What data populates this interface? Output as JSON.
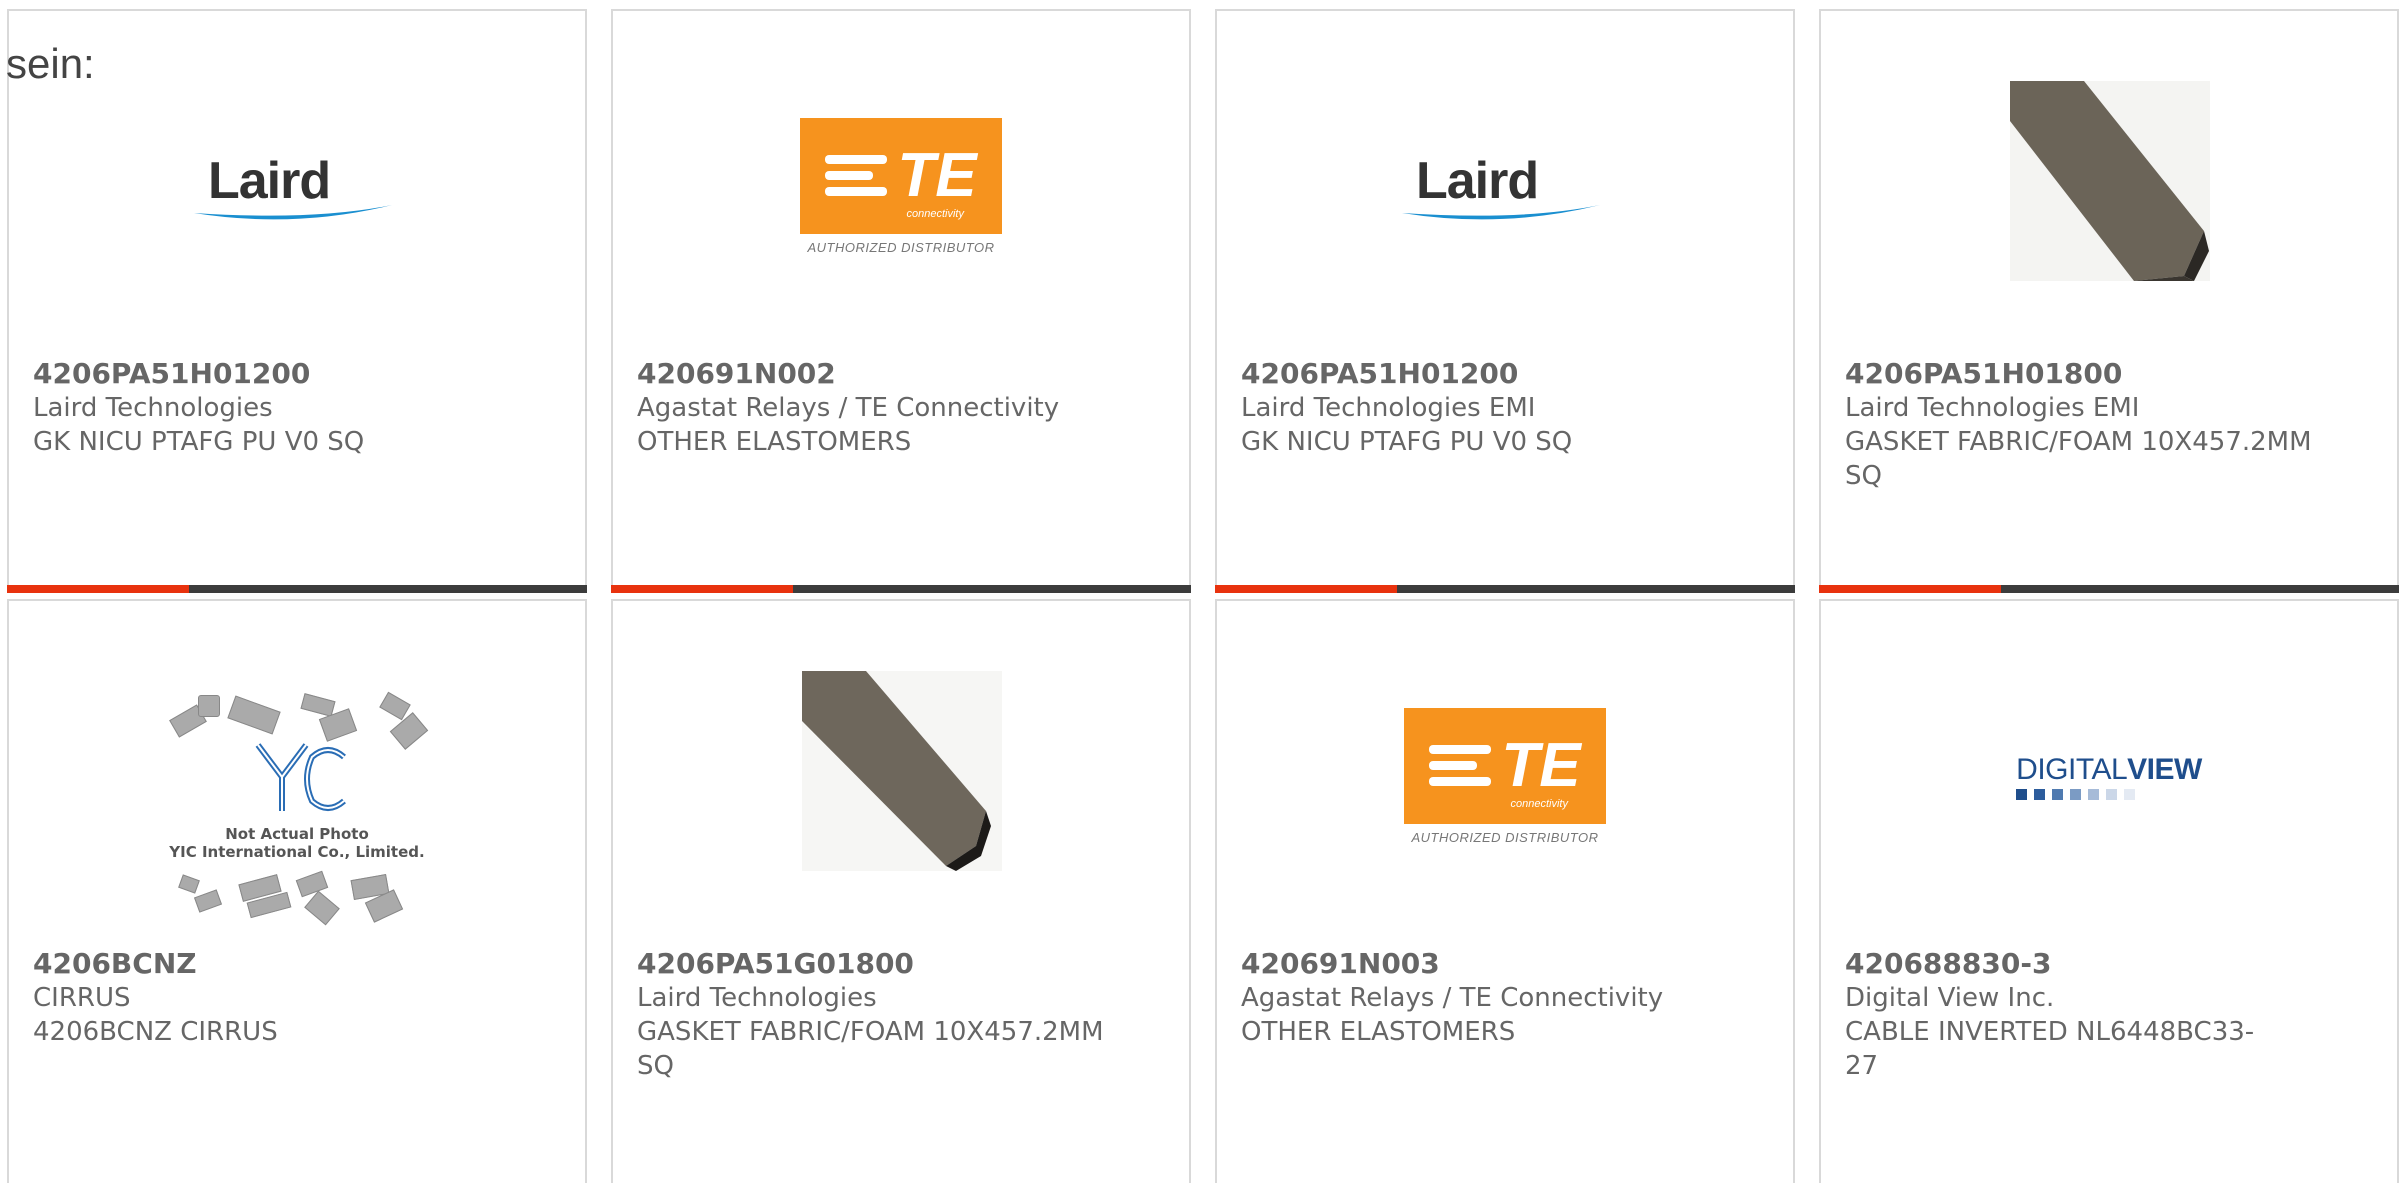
{
  "lead_text": "sein:",
  "colors": {
    "accent": "#e8320e",
    "bar": "#3c3c3c",
    "te_orange": "#f6931e",
    "laird_blue": "#1a8fd0",
    "dv_blue": "#1f4e8c"
  },
  "products": [
    {
      "part_number": "4206PA51H01200",
      "manufacturer": "Laird Technologies",
      "description": "GK NICU PTAFG PU V0 SQ",
      "image": "laird-logo",
      "logo_text": "Laird"
    },
    {
      "part_number": "420691N002",
      "manufacturer": "Agastat Relays / TE Connectivity",
      "description": "OTHER ELASTOMERS",
      "image": "te-logo",
      "logo_text": "TE",
      "logo_sub": "connectivity",
      "logo_caption": "AUTHORIZED DISTRIBUTOR"
    },
    {
      "part_number": "4206PA51H01200",
      "manufacturer": "Laird Technologies EMI",
      "description": "GK NICU PTAFG PU V0 SQ",
      "image": "laird-logo",
      "logo_text": "Laird"
    },
    {
      "part_number": "4206PA51H01800",
      "manufacturer": "Laird Technologies EMI",
      "description": "GASKET FABRIC/FOAM 10X457.2MM SQ",
      "image": "gasket-photo"
    },
    {
      "part_number": "4206BCNZ",
      "manufacturer": "CIRRUS",
      "description": "4206BCNZ CIRRUS",
      "image": "yic-placeholder",
      "logo_text": "YIC",
      "logo_caption_1": "Not Actual Photo",
      "logo_caption_2": "YIC International Co., Limited."
    },
    {
      "part_number": "4206PA51G01800",
      "manufacturer": "Laird Technologies",
      "description": "GASKET FABRIC/FOAM 10X457.2MM SQ",
      "image": "gasket-photo"
    },
    {
      "part_number": "420691N003",
      "manufacturer": "Agastat Relays / TE Connectivity",
      "description": "OTHER ELASTOMERS",
      "image": "te-logo",
      "logo_text": "TE",
      "logo_sub": "connectivity",
      "logo_caption": "AUTHORIZED DISTRIBUTOR"
    },
    {
      "part_number": "420688830-3",
      "manufacturer": "Digital View Inc.",
      "description": "CABLE INVERTED NL6448BC33-27",
      "image": "digitalview-logo",
      "logo_text_1": "DIGITAL",
      "logo_text_2": "VIEW"
    }
  ]
}
